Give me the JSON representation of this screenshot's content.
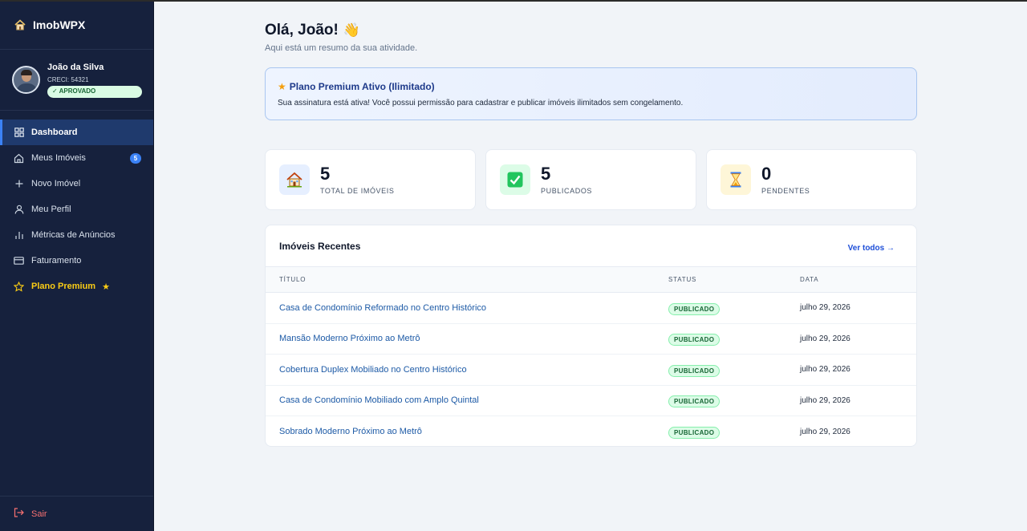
{
  "brand": {
    "name": "ImobWPX"
  },
  "user": {
    "name": "João da Silva",
    "creci": "CRECI: 54321",
    "status": "✓ APROVADO"
  },
  "nav": {
    "items": [
      {
        "label": "Dashboard",
        "icon": "grid-icon",
        "active": true
      },
      {
        "label": "Meus Imóveis",
        "icon": "home-icon",
        "count": "5"
      },
      {
        "label": "Novo Imóvel",
        "icon": "plus-icon"
      },
      {
        "label": "Meu Perfil",
        "icon": "user-icon"
      },
      {
        "label": "Métricas de Anúncios",
        "icon": "bar-chart-icon"
      },
      {
        "label": "Faturamento",
        "icon": "credit-card-icon"
      },
      {
        "label": "Plano Premium",
        "icon": "star-outline-icon",
        "badge": "★"
      }
    ],
    "logout": "Sair"
  },
  "header": {
    "greeting": "Olá, João!",
    "wave": "👋",
    "subtitle": "Aqui está um resumo da sua atividade."
  },
  "premium": {
    "star": "★",
    "title": "Plano Premium Ativo (Ilimitado)",
    "description": "Sua assinatura está ativa! Você possui permissão para cadastrar e publicar imóveis ilimitados sem congelamento."
  },
  "stats": [
    {
      "value": "5",
      "label": "TOTAL DE IMÓVEIS",
      "icon": "house-icon"
    },
    {
      "value": "5",
      "label": "PUBLICADOS",
      "icon": "check-box-icon"
    },
    {
      "value": "0",
      "label": "PENDENTES",
      "icon": "hourglass-icon"
    }
  ],
  "recent": {
    "title": "Imóveis Recentes",
    "see_all": "Ver todos →",
    "columns": {
      "title": "TÍTULO",
      "status": "STATUS",
      "date": "DATA"
    },
    "rows": [
      {
        "title": "Casa de Condomínio Reformado no Centro Histórico",
        "status": "PUBLICADO",
        "date": "julho 29, 2026"
      },
      {
        "title": "Mansão Moderno Próximo ao Metrô",
        "status": "PUBLICADO",
        "date": "julho 29, 2026"
      },
      {
        "title": "Cobertura Duplex Mobiliado no Centro Histórico",
        "status": "PUBLICADO",
        "date": "julho 29, 2026"
      },
      {
        "title": "Casa de Condomínio Mobiliado com Amplo Quintal",
        "status": "PUBLICADO",
        "date": "julho 29, 2026"
      },
      {
        "title": "Sobrado Moderno Próximo ao Metrô",
        "status": "PUBLICADO",
        "date": "julho 29, 2026"
      }
    ]
  }
}
